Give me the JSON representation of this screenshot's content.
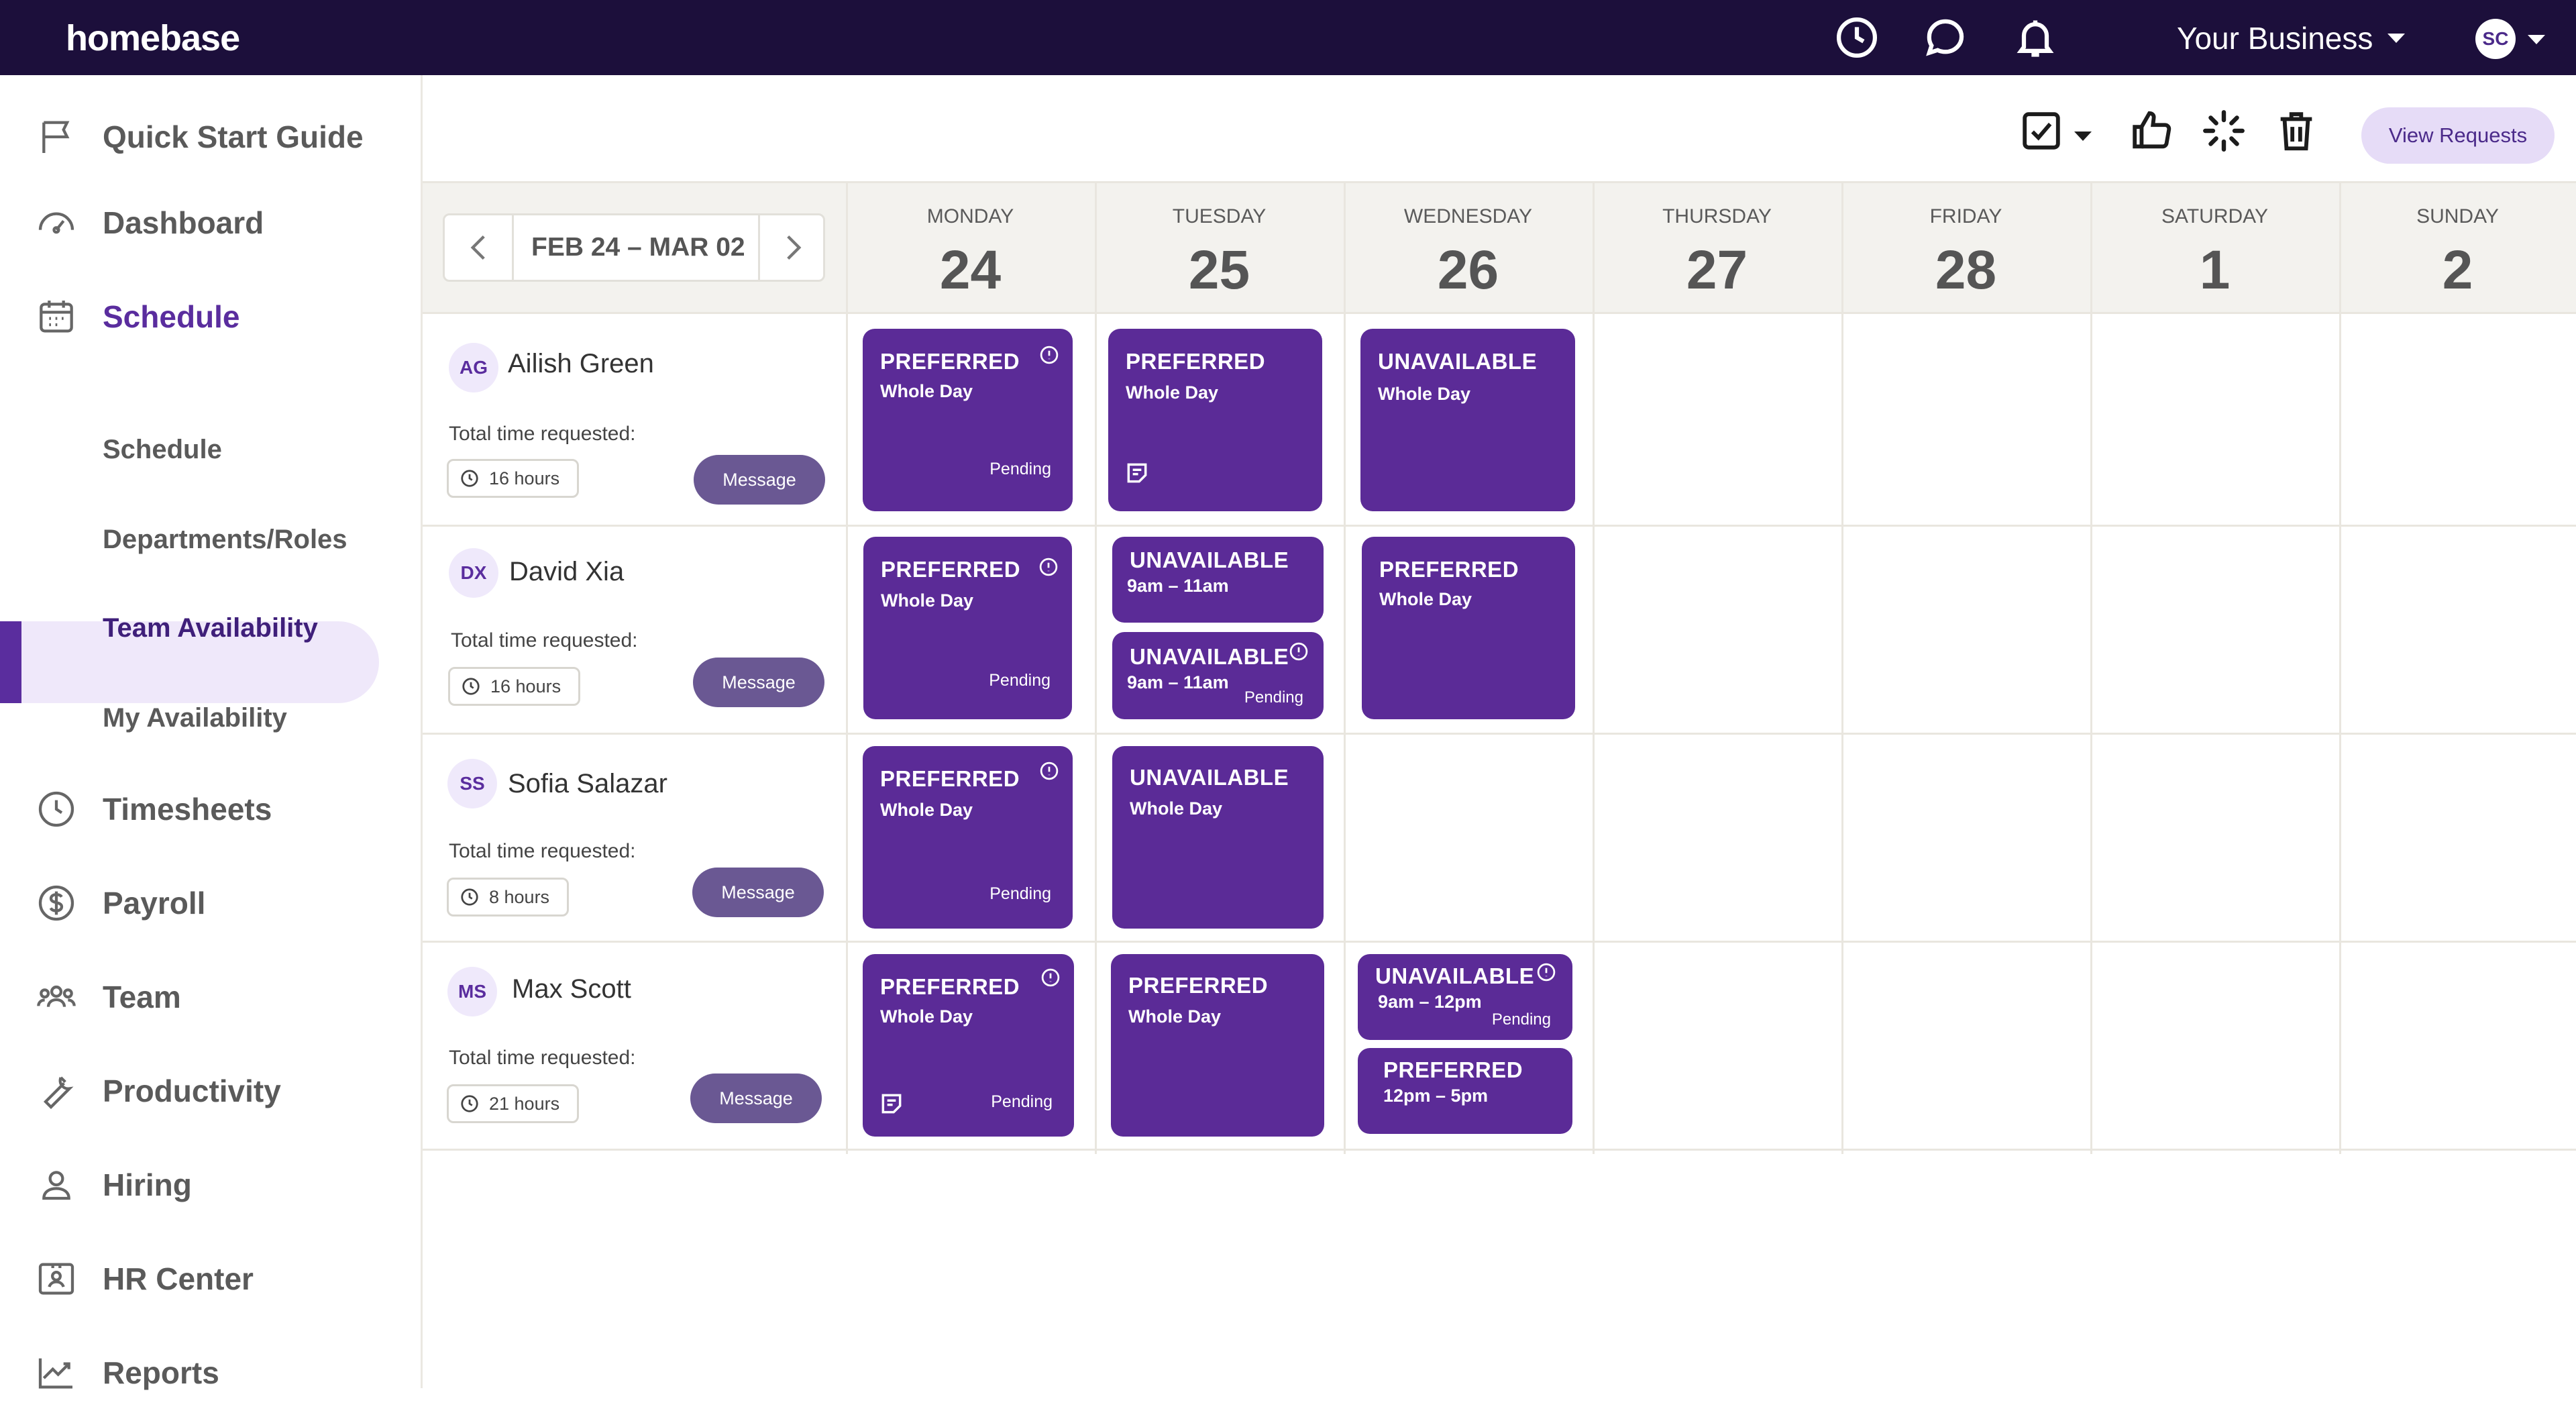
{
  "app": {
    "logo": "homebase",
    "business": "Your Business",
    "user_initials": "SC"
  },
  "sidebar": {
    "items": [
      {
        "label": "Quick Start Guide",
        "icon": "flag-icon"
      },
      {
        "label": "Dashboard",
        "icon": "gauge-icon"
      },
      {
        "label": "Schedule",
        "icon": "calendar-icon",
        "active": true
      },
      {
        "label": "Timesheets",
        "icon": "clock-icon"
      },
      {
        "label": "Payroll",
        "icon": "dollar-icon"
      },
      {
        "label": "Team",
        "icon": "team-icon"
      },
      {
        "label": "Productivity",
        "icon": "wrench-icon"
      },
      {
        "label": "Hiring",
        "icon": "person-icon"
      },
      {
        "label": "HR Center",
        "icon": "badge-icon"
      },
      {
        "label": "Reports",
        "icon": "chart-icon"
      }
    ],
    "sub_items": [
      {
        "label": "Schedule"
      },
      {
        "label": "Departments/Roles"
      },
      {
        "label": "Team Availability",
        "active": true
      },
      {
        "label": "My Availability"
      }
    ]
  },
  "toolbar": {
    "view_requests": "View Requests"
  },
  "calendar": {
    "range_label": "FEB 24 – MAR 02",
    "days": [
      {
        "name": "MONDAY",
        "num": "24"
      },
      {
        "name": "TUESDAY",
        "num": "25"
      },
      {
        "name": "WEDNESDAY",
        "num": "26"
      },
      {
        "name": "THURSDAY",
        "num": "27"
      },
      {
        "name": "FRIDAY",
        "num": "28"
      },
      {
        "name": "SATURDAY",
        "num": "1"
      },
      {
        "name": "SUNDAY",
        "num": "2"
      }
    ]
  },
  "employees": [
    {
      "initials": "AG",
      "name": "Ailish Green",
      "total_label": "Total time requested:",
      "hours": "16 hours",
      "message": "Message",
      "cards": [
        {
          "type": "PREFERRED",
          "time": "Whole Day",
          "status": "Pending"
        },
        {
          "type": "PREFERRED",
          "time": "Whole Day"
        },
        {
          "type": "UNAVAILABLE",
          "time": "Whole Day"
        }
      ]
    },
    {
      "initials": "DX",
      "name": "David Xia",
      "total_label": "Total time requested:",
      "hours": "16 hours",
      "message": "Message",
      "cards": [
        {
          "type": "PREFERRED",
          "time": "Whole Day",
          "status": "Pending"
        },
        {
          "type": "UNAVAILABLE",
          "time": "9am – 11am"
        },
        {
          "type": "UNAVAILABLE",
          "time": "9am – 11am",
          "status": "Pending"
        },
        {
          "type": "PREFERRED",
          "time": "Whole Day"
        }
      ]
    },
    {
      "initials": "SS",
      "name": "Sofia Salazar",
      "total_label": "Total time requested:",
      "hours": "8 hours",
      "message": "Message",
      "cards": [
        {
          "type": "PREFERRED",
          "time": "Whole Day",
          "status": "Pending"
        },
        {
          "type": "UNAVAILABLE",
          "time": "Whole Day"
        }
      ]
    },
    {
      "initials": "MS",
      "name": "Max Scott",
      "total_label": "Total time requested:",
      "hours": "21 hours",
      "message": "Message",
      "cards": [
        {
          "type": "PREFERRED",
          "time": "Whole Day",
          "status": "Pending"
        },
        {
          "type": "PREFERRED",
          "time": "Whole Day"
        },
        {
          "type": "UNAVAILABLE",
          "time": "9am – 12pm",
          "status": "Pending"
        },
        {
          "type": "PREFERRED",
          "time": "12pm – 5pm"
        }
      ]
    }
  ],
  "colors": {
    "topbar": "#1c0f3b",
    "accent": "#5a2d9e",
    "card": "#5b2b97",
    "message_button": "#6a5893"
  }
}
